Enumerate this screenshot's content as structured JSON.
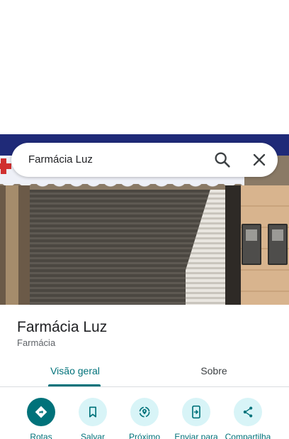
{
  "search": {
    "query": "Farmácia Luz"
  },
  "place": {
    "name": "Farmácia Luz",
    "category": "Farmácia"
  },
  "tabs": [
    {
      "label": "Visão geral",
      "active": true
    },
    {
      "label": "Sobre",
      "active": false
    }
  ],
  "actions": [
    {
      "label": "Rotas",
      "icon": "directions-icon"
    },
    {
      "label": "Salvar",
      "icon": "bookmark-icon"
    },
    {
      "label": "Próximo",
      "icon": "nearby-icon"
    },
    {
      "label": "Enviar para",
      "icon": "send-to-phone-icon"
    },
    {
      "label": "Compartilha",
      "icon": "share-icon"
    }
  ],
  "colors": {
    "accent": "#00727a",
    "action_bg": "#d8f4f7"
  }
}
